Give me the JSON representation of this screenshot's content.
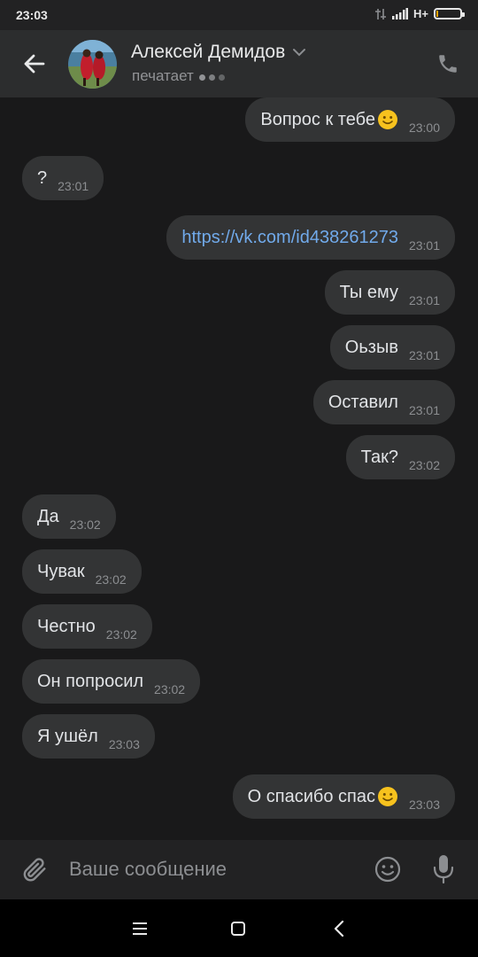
{
  "status_bar": {
    "time": "23:03",
    "network": "H+",
    "battery_level": 0.05
  },
  "header": {
    "contact_name": "Алексей Демидов",
    "status": "печатает"
  },
  "messages": [
    {
      "dir": "out",
      "text": "Вопрос к тебе",
      "emoji": "smile",
      "time": "23:00"
    },
    {
      "dir": "in",
      "text": "?",
      "time": "23:01"
    },
    {
      "dir": "out",
      "text": "https://vk.com/id438261273",
      "link": true,
      "time": "23:01"
    },
    {
      "dir": "out",
      "text": "Ты ему",
      "time": "23:01"
    },
    {
      "dir": "out",
      "text": "Оьзыв",
      "time": "23:01"
    },
    {
      "dir": "out",
      "text": "Оставил",
      "time": "23:01"
    },
    {
      "dir": "out",
      "text": "Так?",
      "time": "23:02"
    },
    {
      "dir": "in",
      "text": "Да",
      "time": "23:02"
    },
    {
      "dir": "in",
      "text": "Чувак",
      "time": "23:02"
    },
    {
      "dir": "in",
      "text": "Честно",
      "time": "23:02"
    },
    {
      "dir": "in",
      "text": "Он попросил",
      "time": "23:02"
    },
    {
      "dir": "in",
      "text": "Я ушёл",
      "time": "23:03"
    },
    {
      "dir": "out",
      "text": "О спасибо спас",
      "emoji": "smile",
      "time": "23:03"
    }
  ],
  "composer": {
    "placeholder": "Ваше сообщение"
  },
  "icons": {
    "back": "arrow-left-icon",
    "call": "phone-icon",
    "attach": "paperclip-icon",
    "emoji": "smiley-icon",
    "mic": "microphone-icon",
    "nav_menu": "menu-icon",
    "nav_home": "home-square-icon",
    "nav_back": "chevron-left-icon"
  },
  "colors": {
    "link": "#71aaeb",
    "bubble": "#333435",
    "background": "#19191a",
    "header": "#2c2d2e"
  }
}
